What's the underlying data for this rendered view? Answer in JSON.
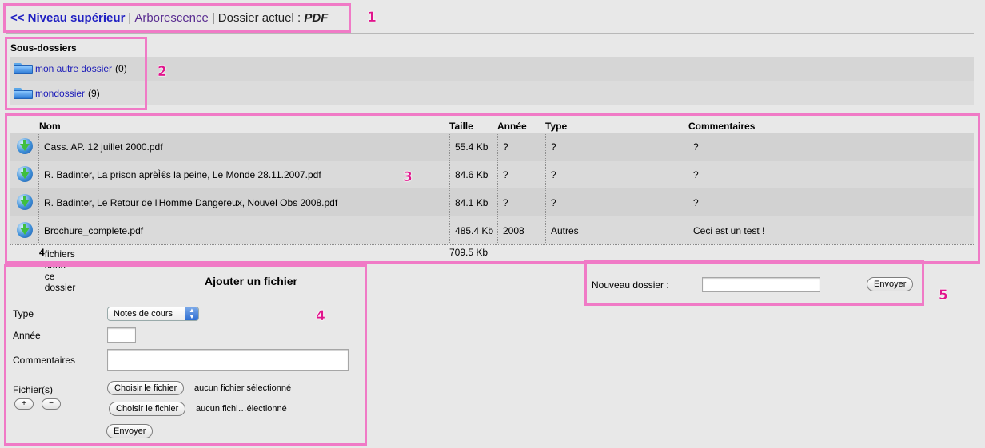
{
  "breadcrumb": {
    "up_label": "<< Niveau supérieur",
    "separator": "|",
    "tree_label": "Arborescence",
    "current_prefix": "Dossier actuel :",
    "current_folder": "PDF"
  },
  "subfolders": {
    "title": "Sous-dossiers",
    "items": [
      {
        "name": "mon autre dossier",
        "count": "(0)"
      },
      {
        "name": "mondossier",
        "count": "(9)"
      }
    ]
  },
  "files": {
    "columns": {
      "name": "Nom",
      "size": "Taille",
      "year": "Année",
      "type": "Type",
      "comments": "Commentaires"
    },
    "rows": [
      {
        "name": "Cass. AP. 12 juillet 2000.pdf",
        "size": "55.4 Kb",
        "year": "?",
        "type": "?",
        "comments": "?"
      },
      {
        "name": "R. Badinter, La prison aprèÌ€s la peine, Le Monde 28.11.2007.pdf",
        "size": "84.6 Kb",
        "year": "?",
        "type": "?",
        "comments": "?"
      },
      {
        "name": "R. Badinter, Le Retour de l'Homme Dangereux, Nouvel Obs 2008.pdf",
        "size": "84.1 Kb",
        "year": "?",
        "type": "?",
        "comments": "?"
      },
      {
        "name": "Brochure_complete.pdf",
        "size": "485.4 Kb",
        "year": "2008",
        "type": "Autres",
        "comments": "Ceci est un test !"
      }
    ],
    "footer": {
      "count": "4",
      "count_text": "fichiers dans ce dossier",
      "total": "709.5 Kb"
    }
  },
  "add_file": {
    "title": "Ajouter un fichier",
    "type_label": "Type",
    "type_value": "Notes de cours",
    "year_label": "Année",
    "year_value": "",
    "comments_label": "Commentaires",
    "comments_value": "",
    "files_label": "Fichier(s)",
    "choose_label": "Choisir le fichier",
    "no_file_1": "aucun fichier sélectionné",
    "no_file_2": "aucun fichi…électionné",
    "plus": "+",
    "minus": "−",
    "submit": "Envoyer"
  },
  "new_folder": {
    "label": "Nouveau dossier :",
    "value": "",
    "submit": "Envoyer"
  },
  "annotations": [
    "1",
    "2",
    "3",
    "4",
    "5"
  ],
  "colors": {
    "highlight": "#f07ac6",
    "annotation": "#e0148c",
    "link": "#1a1ab8"
  }
}
